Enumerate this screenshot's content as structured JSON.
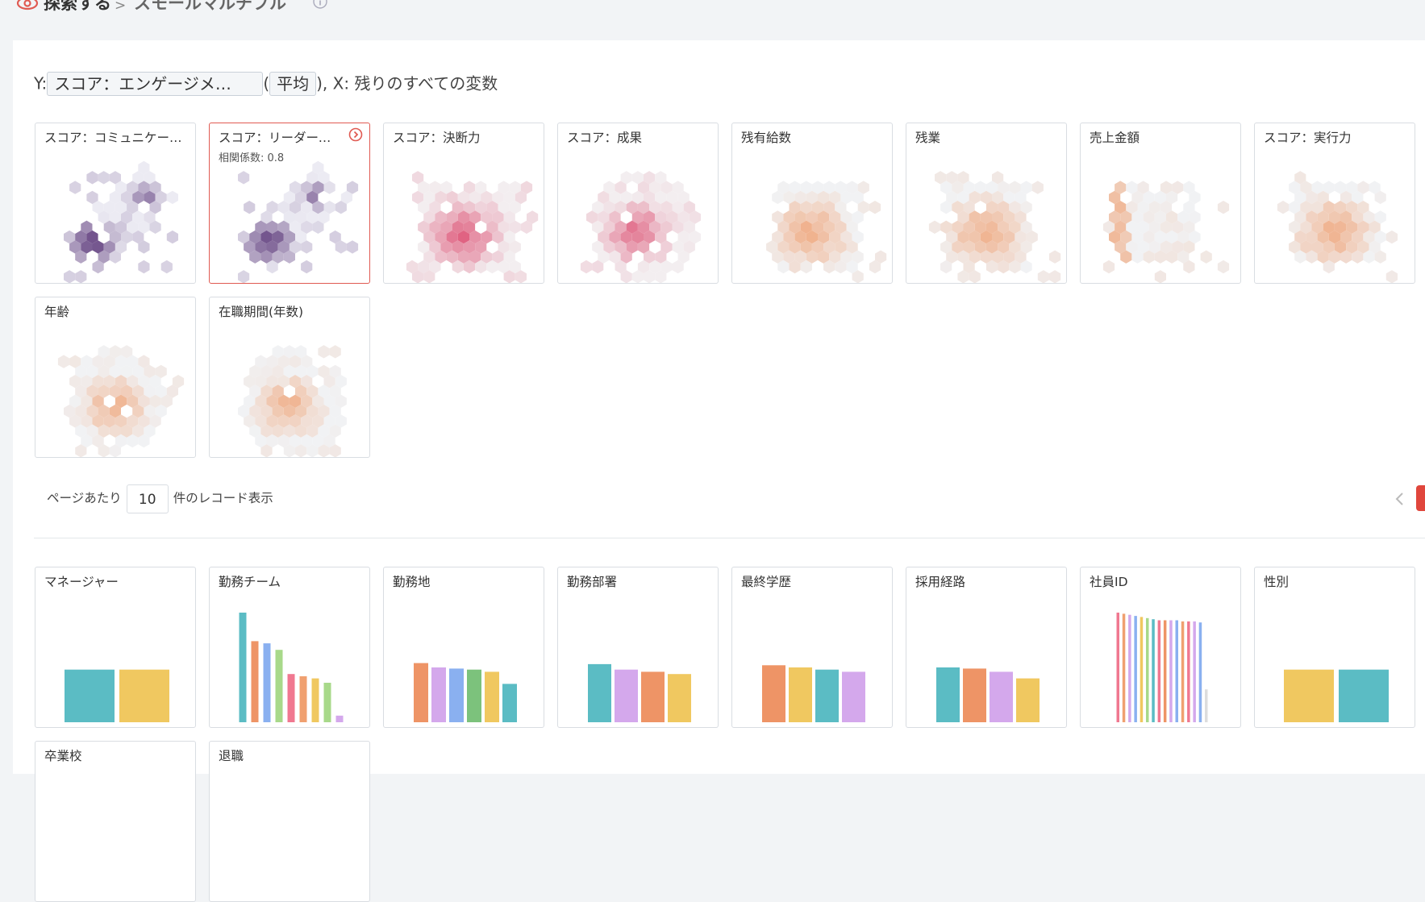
{
  "breadcrumb": {
    "explore_label": "探索する",
    "separator": ">",
    "current_label": "スモールマルチプル"
  },
  "selector": {
    "y_prefix": "Y:",
    "y_variable": "スコア：エンゲージメ…",
    "agg_open": "(",
    "aggregation": "平均",
    "agg_close": "),",
    "x_text": "X: 残りのすべての変数"
  },
  "colors": {
    "purple": "#5a2d82",
    "red": "#e06070",
    "orange": "#f0a070",
    "accent": "#e05a52",
    "teal": "#5bbcc4",
    "yellow": "#f0c860",
    "salmon": "#ee9466",
    "lavender": "#d4a8ec"
  },
  "hexbin_cards": [
    {
      "title": "スコア：コミュニケー…",
      "palette": "purple",
      "active": false
    },
    {
      "title": "スコア：リーダーシ…",
      "palette": "purple",
      "active": true,
      "correlation_label": "相関係数: 0.8"
    },
    {
      "title": "スコア：決断力",
      "palette": "red",
      "active": false
    },
    {
      "title": "スコア：成果",
      "palette": "red",
      "active": false
    },
    {
      "title": "残有給数",
      "palette": "orange",
      "active": false
    },
    {
      "title": "残業",
      "palette": "orange",
      "active": false
    },
    {
      "title": "売上金額",
      "palette": "orange",
      "active": false
    },
    {
      "title": "スコア：実行力",
      "palette": "orange",
      "active": false
    },
    {
      "title": "年齢",
      "palette": "orange",
      "active": false
    },
    {
      "title": "在職期間(年数)",
      "palette": "orange",
      "active": false
    }
  ],
  "pagination": {
    "per_page_label": "ページあたり",
    "per_page_value": "10",
    "records_label": "件のレコード表示"
  },
  "bar_cards": [
    {
      "title": "マネージャー",
      "values": [
        0.48,
        0.48
      ],
      "colors": [
        "#5bbcc4",
        "#f0c860"
      ]
    },
    {
      "title": "勤務チーム",
      "values": [
        1.0,
        0.74,
        0.72,
        0.66,
        0.44,
        0.42,
        0.4,
        0.36,
        0.06
      ],
      "colors": [
        "#5bbcc4",
        "#ee9466",
        "#8ab0f0",
        "#a8d98a",
        "#f07890",
        "#f0a070",
        "#f0c860",
        "#a8d98a",
        "#d4a8ec"
      ]
    },
    {
      "title": "勤務地",
      "values": [
        0.54,
        0.5,
        0.49,
        0.48,
        0.46,
        0.35
      ],
      "colors": [
        "#ee9466",
        "#d4a8ec",
        "#8ab0f0",
        "#7cc27c",
        "#f0c860",
        "#5bbcc4"
      ]
    },
    {
      "title": "勤務部署",
      "values": [
        0.53,
        0.48,
        0.46,
        0.44
      ],
      "colors": [
        "#5bbcc4",
        "#d4a8ec",
        "#ee9466",
        "#f0c860"
      ]
    },
    {
      "title": "最終学歴",
      "values": [
        0.52,
        0.5,
        0.48,
        0.46
      ],
      "colors": [
        "#ee9466",
        "#f0c860",
        "#5bbcc4",
        "#d4a8ec"
      ]
    },
    {
      "title": "採用経路",
      "values": [
        0.5,
        0.49,
        0.46,
        0.4
      ],
      "colors": [
        "#5bbcc4",
        "#ee9466",
        "#d4a8ec",
        "#f0c860"
      ]
    },
    {
      "title": "社員ID",
      "values": [
        1.0,
        0.99,
        0.98,
        0.97,
        0.96,
        0.95,
        0.94,
        0.93,
        0.93,
        0.93,
        0.93,
        0.92,
        0.92,
        0.92,
        0.91,
        0.3
      ],
      "colors": [
        "#f07890",
        "#f0a070",
        "#d4a8ec",
        "#8ab0f0",
        "#f0c860",
        "#a8d98a",
        "#5bbcc4",
        "#f07890",
        "#ee9466",
        "#d4a8ec",
        "#8ab0f0",
        "#f0a070",
        "#f07890",
        "#d4a8ec",
        "#8ab0f0",
        "#dddddd"
      ]
    },
    {
      "title": "性別",
      "values": [
        0.48,
        0.48
      ],
      "colors": [
        "#f0c860",
        "#5bbcc4"
      ]
    },
    {
      "title": "卒業校",
      "values": [],
      "colors": []
    },
    {
      "title": "退職",
      "values": [],
      "colors": []
    }
  ]
}
